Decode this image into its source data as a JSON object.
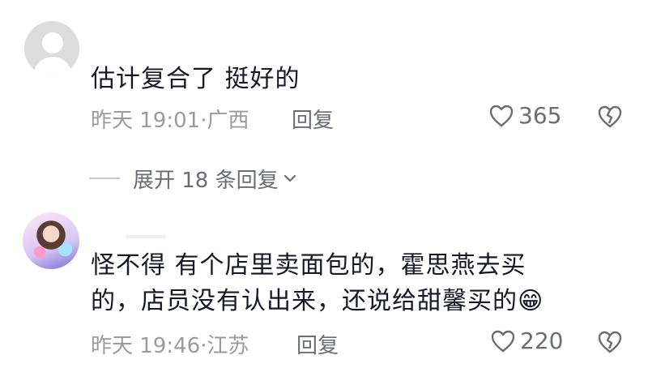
{
  "comments": [
    {
      "avatar": "default-avatar",
      "text_lines": [
        "估计复合了  挺好的"
      ],
      "meta": "昨天 19:01·广西",
      "reply_label": "回复",
      "likes": "365",
      "expand_label": "展开 18 条回复"
    },
    {
      "avatar": "user-photo-avatar",
      "text_lines": [
        "怪不得  有个店里卖面包的，霍思燕去买",
        "的，店员没有认出来，还说给甜馨买的😁"
      ],
      "meta": "昨天 19:46·江苏",
      "reply_label": "回复",
      "likes": "220"
    }
  ],
  "icons": {
    "like": "heart-outline-icon",
    "dislike": "broken-heart-icon",
    "expand": "chevron-down-icon"
  },
  "colors": {
    "text": "#161823",
    "meta": "#9a9ba1",
    "action": "#6b6d75"
  }
}
